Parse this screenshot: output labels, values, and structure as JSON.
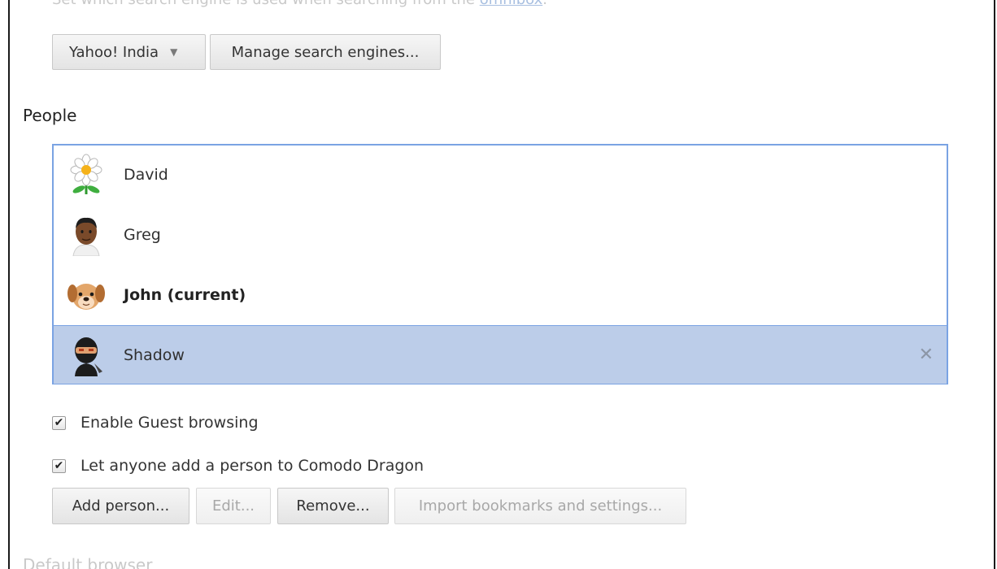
{
  "search": {
    "description": "Set which search engine is used when searching from the ",
    "description_link": "omnibox",
    "description_end": ".",
    "engine_selected": "Yahoo! India",
    "manage_label": "Manage search engines..."
  },
  "people": {
    "title": "People",
    "items": [
      {
        "name": "David",
        "avatar": "daisy-flower-icon"
      },
      {
        "name": "Greg",
        "avatar": "man-avatar-icon"
      },
      {
        "name": "John (current)",
        "avatar": "puppy-avatar-icon",
        "current": true
      },
      {
        "name": "Shadow",
        "avatar": "ninja-avatar-icon",
        "selected": true
      }
    ],
    "remove_glyph": "✕",
    "guest_browsing_label": "Enable Guest browsing",
    "guest_browsing_checked": true,
    "anyone_add_label": "Let anyone add a person to Comodo Dragon",
    "anyone_add_checked": true,
    "buttons": {
      "add": "Add person...",
      "edit": "Edit...",
      "remove": "Remove...",
      "import": "Import bookmarks and settings..."
    }
  },
  "default_browser": {
    "title": "Default browser"
  },
  "colors": {
    "selection": "#bccde9",
    "focus_border": "#7aa3e3"
  }
}
